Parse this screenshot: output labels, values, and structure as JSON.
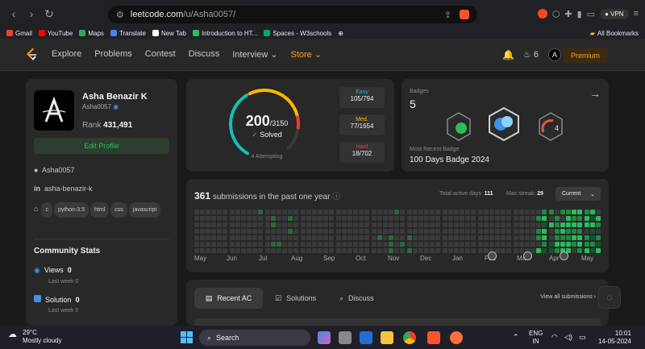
{
  "browser": {
    "url_host": "leetcode.com",
    "url_path": "/u/Asha0057/",
    "vpn_label": "VPN"
  },
  "bookmarks": [
    {
      "label": "Gmail",
      "color": "#ea4335"
    },
    {
      "label": "YouTube",
      "color": "#ff0000"
    },
    {
      "label": "Maps",
      "color": "#34a853"
    },
    {
      "label": "Translate",
      "color": "#4285f4"
    },
    {
      "label": "New Tab",
      "color": "#ffffff"
    },
    {
      "label": "Introduction to HT...",
      "color": "#2cbb5d"
    },
    {
      "label": "Spaces - W3schools",
      "color": "#04aa6d"
    }
  ],
  "bookmarks_all": "All Bookmarks",
  "nav": {
    "items": [
      "Explore",
      "Problems",
      "Contest",
      "Discuss",
      "Interview ⌄"
    ],
    "store": "Store ⌄",
    "streak": "6",
    "premium": "Premium"
  },
  "profile": {
    "name": "Asha Benazir K",
    "username": "Asha0057",
    "rank_label": "Rank",
    "rank": "431,491",
    "edit": "Edit Profile",
    "github": "Asha0057",
    "linkedin": "asha-benazir-k",
    "tags": [
      "c",
      "python-3.5",
      "html",
      "css",
      "javascript"
    ]
  },
  "community": {
    "title": "Community Stats",
    "views_label": "Views",
    "views": "0",
    "views_sub": "Last week 0",
    "solution_label": "Solution",
    "solution": "0",
    "solution_sub": "Last week 0"
  },
  "solved": {
    "count": "200",
    "total": "/3150",
    "label": "Solved",
    "attempting": "4 Attempting",
    "progress": 0.0635,
    "easy_label": "Easy",
    "easy": "105/794",
    "med_label": "Med.",
    "med": "77/1654",
    "hard_label": "Hard",
    "hard": "18/702",
    "colors": {
      "easy": "#1cbaba",
      "med": "#ffb700",
      "hard": "#f63737"
    }
  },
  "badges": {
    "title": "Badges",
    "count": "5",
    "recent_label": "Most Recent Badge",
    "recent": "100 Days Badge 2024"
  },
  "calendar": {
    "count": "361",
    "label": "submissions in the past one year",
    "active_label": "Total active days:",
    "active": "111",
    "streak_label": "Max streak:",
    "streak": "29",
    "dropdown": "Current",
    "months": [
      "May",
      "Jun",
      "Jul",
      "Aug",
      "Sep",
      "Oct",
      "Nov",
      "Dec",
      "Jan",
      "Feb",
      "Mar",
      "Apr",
      "May"
    ]
  },
  "tabs": {
    "recent": "Recent AC",
    "solutions": "Solutions",
    "discuss": "Discuss",
    "view_all": "View all submissions"
  },
  "taskbar": {
    "temp": "29°C",
    "weather": "Mostly cloudy",
    "search": "Search",
    "lang1": "ENG",
    "lang2": "IN",
    "time": "10:01",
    "date": "14-05-2024"
  }
}
